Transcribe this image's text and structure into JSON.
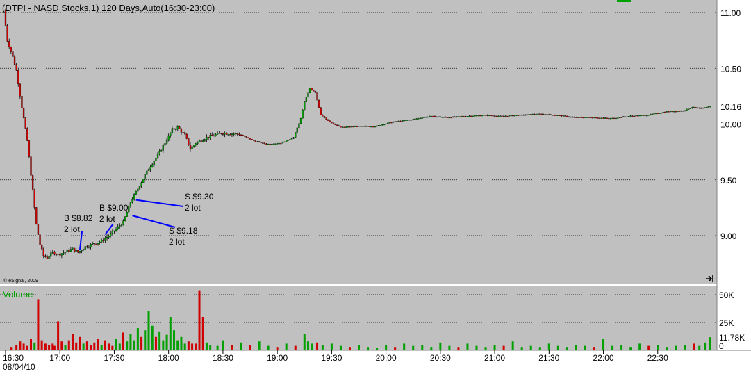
{
  "header": {
    "symbol_title": "(DTPI - NASD Stocks,1) 120 Days,Auto(16:30-23:00)"
  },
  "copyright": "© eSignal, 2009",
  "colors": {
    "panel_bg": "#c0c0c0",
    "grid": "#000000",
    "up": "#00a000",
    "down": "#d00000",
    "annotation_line": "#0000ff",
    "volume_label": "#00a000"
  },
  "icons": {
    "corner": "expand-arrow-icon"
  },
  "chart_data": [
    {
      "type": "candlestick",
      "title": "(DTPI - NASD Stocks,1) 120 Days,Auto(16:30-23:00)",
      "symbol": "DTPI",
      "y_ticks": [
        "11.00",
        "10.50",
        "10.16",
        "10.00",
        "9.50",
        "9.00"
      ],
      "ylim": [
        8.7,
        11.05
      ],
      "grid": true,
      "x_ticks": [
        "16:30",
        "17:00",
        "17:30",
        "18:00",
        "18:30",
        "19:00",
        "19:30",
        "20:00",
        "20:30",
        "21:00",
        "21:30",
        "22:00",
        "22:30"
      ],
      "x_sublabel": "08/04/10",
      "xlim": [
        "16:30",
        "23:00"
      ],
      "last_price": "10.16",
      "price_path": [
        [
          "16:30",
          11.02
        ],
        [
          "16:32",
          10.75
        ],
        [
          "16:35",
          10.6
        ],
        [
          "16:37",
          10.48
        ],
        [
          "16:40",
          10.15
        ],
        [
          "16:43",
          9.85
        ],
        [
          "16:46",
          9.4
        ],
        [
          "16:48",
          9.1
        ],
        [
          "16:50",
          8.92
        ],
        [
          "16:52",
          8.82
        ],
        [
          "16:54",
          8.8
        ],
        [
          "16:57",
          8.85
        ],
        [
          "17:00",
          8.83
        ],
        [
          "17:05",
          8.86
        ],
        [
          "17:08",
          8.88
        ],
        [
          "17:11",
          8.85
        ],
        [
          "17:15",
          8.9
        ],
        [
          "17:20",
          8.93
        ],
        [
          "17:24",
          8.95
        ],
        [
          "17:28",
          9.0
        ],
        [
          "17:32",
          9.06
        ],
        [
          "17:36",
          9.12
        ],
        [
          "17:40",
          9.3
        ],
        [
          "17:45",
          9.45
        ],
        [
          "17:50",
          9.6
        ],
        [
          "17:55",
          9.72
        ],
        [
          "18:00",
          9.86
        ],
        [
          "18:03",
          9.95
        ],
        [
          "18:06",
          9.97
        ],
        [
          "18:10",
          9.9
        ],
        [
          "18:13",
          9.78
        ],
        [
          "18:16",
          9.83
        ],
        [
          "18:22",
          9.88
        ],
        [
          "18:30",
          9.92
        ],
        [
          "18:40",
          9.91
        ],
        [
          "18:48",
          9.85
        ],
        [
          "18:55",
          9.82
        ],
        [
          "19:03",
          9.83
        ],
        [
          "19:10",
          9.88
        ],
        [
          "19:14",
          10.05
        ],
        [
          "19:16",
          10.2
        ],
        [
          "19:19",
          10.32
        ],
        [
          "19:22",
          10.28
        ],
        [
          "19:25",
          10.08
        ],
        [
          "19:30",
          10.02
        ],
        [
          "19:36",
          9.97
        ],
        [
          "19:45",
          9.98
        ],
        [
          "19:55",
          9.98
        ],
        [
          "20:05",
          10.02
        ],
        [
          "20:15",
          10.04
        ],
        [
          "20:25",
          10.07
        ],
        [
          "20:35",
          10.06
        ],
        [
          "20:45",
          10.07
        ],
        [
          "20:55",
          10.08
        ],
        [
          "21:05",
          10.07
        ],
        [
          "21:15",
          10.08
        ],
        [
          "21:25",
          10.09
        ],
        [
          "21:35",
          10.08
        ],
        [
          "21:45",
          10.06
        ],
        [
          "21:55",
          10.06
        ],
        [
          "22:05",
          10.05
        ],
        [
          "22:15",
          10.07
        ],
        [
          "22:25",
          10.08
        ],
        [
          "22:35",
          10.11
        ],
        [
          "22:45",
          10.12
        ],
        [
          "22:50",
          10.15
        ],
        [
          "22:55",
          10.14
        ],
        [
          "23:00",
          10.16
        ]
      ],
      "annotations": [
        {
          "line1": "B $8.82",
          "line2": "2 lot",
          "time": "17:11",
          "price": 8.87
        },
        {
          "line1": "B $9.00",
          "line2": "2 lot",
          "time": "17:25",
          "price": 9.01
        },
        {
          "line1": "S $9.30",
          "line2": "2 lot",
          "time": "17:42",
          "price": 9.32
        },
        {
          "line1": "S $9.18",
          "line2": "2 lot",
          "time": "17:40",
          "price": 9.18
        }
      ]
    },
    {
      "type": "bar",
      "title": "Volume",
      "y_ticks": [
        "50K",
        "25K",
        "11.78K",
        "0"
      ],
      "ylim": [
        0,
        55000
      ],
      "last_volume": "11.78K",
      "xlim": [
        "16:30",
        "23:00"
      ],
      "bars": [
        [
          "16:33",
          3000,
          "down"
        ],
        [
          "16:36",
          5000,
          "down"
        ],
        [
          "16:38",
          8000,
          "down"
        ],
        [
          "16:40",
          6000,
          "down"
        ],
        [
          "16:42",
          4000,
          "down"
        ],
        [
          "16:44",
          10000,
          "down"
        ],
        [
          "16:46",
          7000,
          "up"
        ],
        [
          "16:48",
          46000,
          "down"
        ],
        [
          "16:50",
          9000,
          "down"
        ],
        [
          "16:52",
          6000,
          "down"
        ],
        [
          "16:54",
          5000,
          "down"
        ],
        [
          "16:56",
          6000,
          "down"
        ],
        [
          "16:57",
          4000,
          "down"
        ],
        [
          "16:59",
          26000,
          "down"
        ],
        [
          "17:01",
          8000,
          "down"
        ],
        [
          "17:03",
          5000,
          "up"
        ],
        [
          "17:05",
          9000,
          "down"
        ],
        [
          "17:07",
          15000,
          "down"
        ],
        [
          "17:09",
          7000,
          "down"
        ],
        [
          "17:11",
          12000,
          "down"
        ],
        [
          "17:13",
          6000,
          "up"
        ],
        [
          "17:15",
          8000,
          "down"
        ],
        [
          "17:17",
          5000,
          "down"
        ],
        [
          "17:19",
          7000,
          "down"
        ],
        [
          "17:21",
          10000,
          "down"
        ],
        [
          "17:23",
          5000,
          "up"
        ],
        [
          "17:25",
          9000,
          "down"
        ],
        [
          "17:27",
          6000,
          "down"
        ],
        [
          "17:29",
          4000,
          "down"
        ],
        [
          "17:31",
          10000,
          "up"
        ],
        [
          "17:33",
          6000,
          "up"
        ],
        [
          "17:35",
          16000,
          "down"
        ],
        [
          "17:37",
          8000,
          "up"
        ],
        [
          "17:39",
          15000,
          "up"
        ],
        [
          "17:41",
          9000,
          "up"
        ],
        [
          "17:43",
          20000,
          "up"
        ],
        [
          "17:45",
          12000,
          "down"
        ],
        [
          "17:47",
          18000,
          "up"
        ],
        [
          "17:49",
          35000,
          "up"
        ],
        [
          "17:51",
          22000,
          "up"
        ],
        [
          "17:53",
          12000,
          "down"
        ],
        [
          "17:55",
          17000,
          "up"
        ],
        [
          "17:57",
          9000,
          "up"
        ],
        [
          "17:59",
          14000,
          "up"
        ],
        [
          "18:01",
          30000,
          "up"
        ],
        [
          "18:03",
          18000,
          "up"
        ],
        [
          "18:05",
          9000,
          "up"
        ],
        [
          "18:07",
          12000,
          "up"
        ],
        [
          "18:09",
          6000,
          "up"
        ],
        [
          "18:11",
          8000,
          "down"
        ],
        [
          "18:13",
          6000,
          "down"
        ],
        [
          "18:15",
          6000,
          "down"
        ],
        [
          "18:17",
          54000,
          "down"
        ],
        [
          "18:19",
          30000,
          "down"
        ],
        [
          "18:21",
          7000,
          "up"
        ],
        [
          "18:23",
          5000,
          "up"
        ],
        [
          "18:27",
          4000,
          "up"
        ],
        [
          "18:30",
          9000,
          "up"
        ],
        [
          "18:35",
          5000,
          "down"
        ],
        [
          "18:40",
          7000,
          "up"
        ],
        [
          "18:45",
          5000,
          "down"
        ],
        [
          "18:50",
          8000,
          "up"
        ],
        [
          "18:55",
          4000,
          "up"
        ],
        [
          "19:00",
          3000,
          "down"
        ],
        [
          "19:05",
          6000,
          "up"
        ],
        [
          "19:10",
          4000,
          "down"
        ],
        [
          "19:15",
          15000,
          "up"
        ],
        [
          "19:17",
          8000,
          "up"
        ],
        [
          "19:19",
          6000,
          "up"
        ],
        [
          "19:22",
          7000,
          "down"
        ],
        [
          "19:25",
          5000,
          "up"
        ],
        [
          "19:30",
          6000,
          "up"
        ],
        [
          "19:35",
          4000,
          "up"
        ],
        [
          "19:40",
          3000,
          "down"
        ],
        [
          "19:45",
          5000,
          "up"
        ],
        [
          "19:50",
          3000,
          "up"
        ],
        [
          "19:55",
          2000,
          "up"
        ],
        [
          "20:00",
          5000,
          "up"
        ],
        [
          "20:05",
          3000,
          "down"
        ],
        [
          "20:10",
          6000,
          "up"
        ],
        [
          "20:15",
          4000,
          "up"
        ],
        [
          "20:20",
          5000,
          "up"
        ],
        [
          "20:25",
          3000,
          "up"
        ],
        [
          "20:30",
          7000,
          "up"
        ],
        [
          "20:35",
          4000,
          "up"
        ],
        [
          "20:40",
          3000,
          "down"
        ],
        [
          "20:45",
          6000,
          "up"
        ],
        [
          "20:50",
          4000,
          "up"
        ],
        [
          "20:55",
          3000,
          "up"
        ],
        [
          "21:00",
          5000,
          "up"
        ],
        [
          "21:05",
          4000,
          "down"
        ],
        [
          "21:10",
          8000,
          "up"
        ],
        [
          "21:15",
          3000,
          "up"
        ],
        [
          "21:20",
          4000,
          "up"
        ],
        [
          "21:25",
          3000,
          "up"
        ],
        [
          "21:30",
          6000,
          "up"
        ],
        [
          "21:35",
          4000,
          "up"
        ],
        [
          "21:40",
          3000,
          "up"
        ],
        [
          "21:45",
          5000,
          "up"
        ],
        [
          "21:50",
          4000,
          "up"
        ],
        [
          "21:55",
          3000,
          "down"
        ],
        [
          "22:00",
          10000,
          "up"
        ],
        [
          "22:05",
          4000,
          "up"
        ],
        [
          "22:10",
          5000,
          "up"
        ],
        [
          "22:15",
          3000,
          "up"
        ],
        [
          "22:20",
          6000,
          "up"
        ],
        [
          "22:25",
          4000,
          "down"
        ],
        [
          "22:30",
          5000,
          "up"
        ],
        [
          "22:35",
          3000,
          "up"
        ],
        [
          "22:40",
          4000,
          "up"
        ],
        [
          "22:45",
          5000,
          "up"
        ],
        [
          "22:50",
          6000,
          "down"
        ],
        [
          "22:53",
          4000,
          "up"
        ],
        [
          "22:56",
          7000,
          "up"
        ],
        [
          "22:59",
          11780,
          "up"
        ]
      ]
    }
  ]
}
